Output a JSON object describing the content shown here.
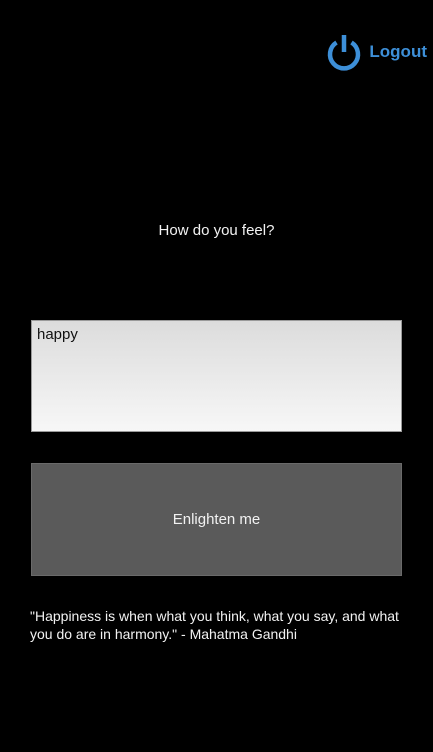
{
  "header": {
    "logout_label": "Logout",
    "logout_icon": "power-icon",
    "accent_color": "#3d8fd8"
  },
  "main": {
    "prompt": "How do you feel?",
    "mood_value": "happy",
    "enlighten_label": "Enlighten me",
    "quote": "\"Happiness is when what you think, what you say, and what you do are in harmony.\" - Mahatma Gandhi"
  }
}
